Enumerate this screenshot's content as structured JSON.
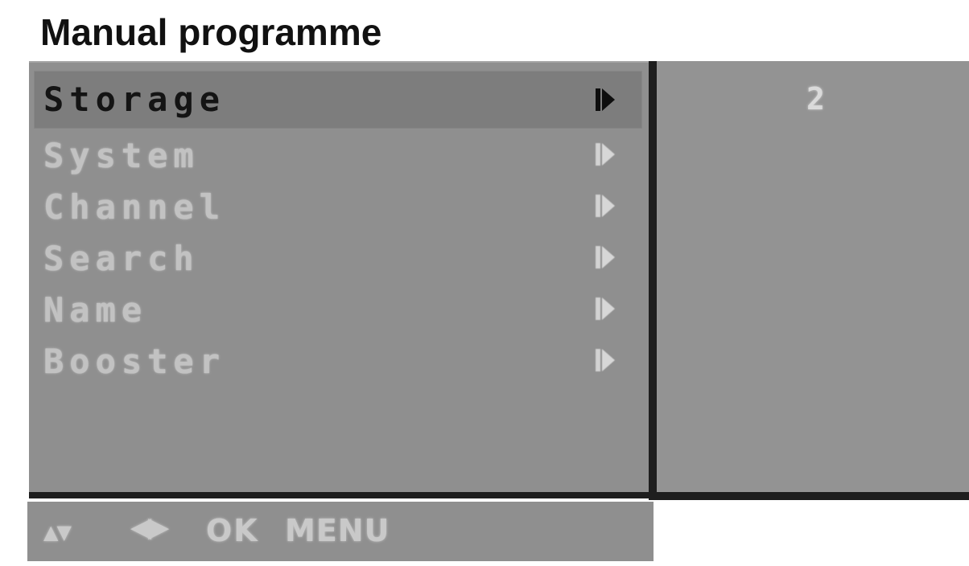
{
  "page": {
    "title": "Manual programme"
  },
  "menu": {
    "items": [
      {
        "label": "Storage",
        "selected": true
      },
      {
        "label": "System",
        "selected": false
      },
      {
        "label": "Channel",
        "selected": false
      },
      {
        "label": "Search",
        "selected": false
      },
      {
        "label": "Name",
        "selected": false
      },
      {
        "label": "Booster",
        "selected": false
      }
    ],
    "arrow_icon": "right-arrow-icon"
  },
  "value_panel": {
    "value": "2"
  },
  "nav_bar": {
    "updown": "▲▼",
    "leftright": "◀▶",
    "ok": "OK",
    "menu": "MENU"
  },
  "colors": {
    "panel_bg": "#8f8f8f",
    "selected_bg": "#7d7d7d",
    "border": "#1e1e1e",
    "selected_text": "#141414",
    "inactive_text": "#c2c2c2"
  }
}
